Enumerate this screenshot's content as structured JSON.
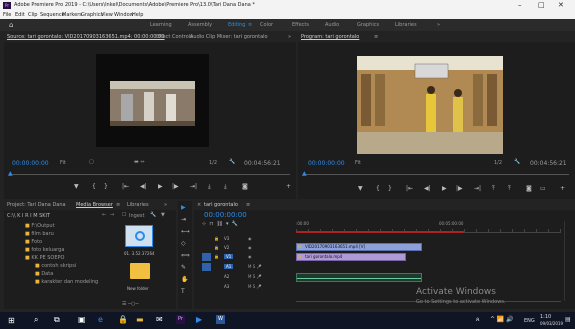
{
  "window": {
    "title": "Adobe Premiere Pro 2019 - C:\\Users\\Inkel\\Documents\\Adobe\\Premiere Pro\\13.0\\Tari Dana Dana *",
    "minimize": "–",
    "maximize": "□",
    "close": "✕"
  },
  "menu": [
    "File",
    "Edit",
    "Clip",
    "Sequence",
    "Markers",
    "Graphics",
    "View",
    "Window",
    "Help"
  ],
  "workspaces": [
    "Learning",
    "Assembly",
    "Editing",
    "Color",
    "Effects",
    "Audio",
    "Graphics",
    "Libraries",
    "»"
  ],
  "source": {
    "tabs": [
      "Source: tari gorontalo: VID20170903163651.mp4: 00:00:00:00",
      "Effect Controls",
      "Audio Clip Mixer: tari gorontalo",
      "»"
    ],
    "timecode_left": "00:00:00:00",
    "fit": "Fit",
    "ratio": "1/2",
    "timecode_right": "00:04:56:21"
  },
  "program": {
    "tab": "Program: tari gorontalo",
    "timecode_left": "00:00:00:00",
    "fit": "Fit",
    "ratio": "1/2",
    "timecode_right": "00:04:56:21"
  },
  "project": {
    "tabs": [
      "Project: Tari Dana Dana",
      "Media Browser",
      "Libraries",
      "»"
    ],
    "path": "C:\\\\ K I R I M SKIT",
    "ingest": "Ingest",
    "tree": [
      "F:\\Output",
      "film baru",
      "Foto",
      "foto keluarga",
      "KK PE SOEPO",
      "contoh skripsi",
      "Data",
      "karakter dan modeling"
    ],
    "thumbs": [
      {
        "name": "01. 3.52.37264",
        "icon": "disc-icon"
      },
      {
        "name": "New folder",
        "icon": "folder-icon"
      }
    ]
  },
  "timeline": {
    "tab": "tari gorontalo",
    "timecode": "00:00:00:00",
    "ruler": [
      ":00:00",
      "00:05:00:00"
    ],
    "tracks": {
      "video": [
        "V3",
        "V2",
        "V1"
      ],
      "audio": [
        "A1",
        "A2",
        "A3"
      ]
    },
    "clips": {
      "video": "VID20170903163651.mp4 [V]",
      "fx": "tari gorontalo.mp4"
    }
  },
  "watermark": {
    "title": "Activate Windows",
    "subtitle": "Go to Settings to activate Windows."
  },
  "tray": {
    "lang": "ENG",
    "time": "1:10",
    "date": "09/03/2019"
  },
  "colors": {
    "accent": "#2d8ceb",
    "clip_video": "#8da0d8",
    "clip_fx": "#b09ad6",
    "active_track": "#2f62a8"
  }
}
